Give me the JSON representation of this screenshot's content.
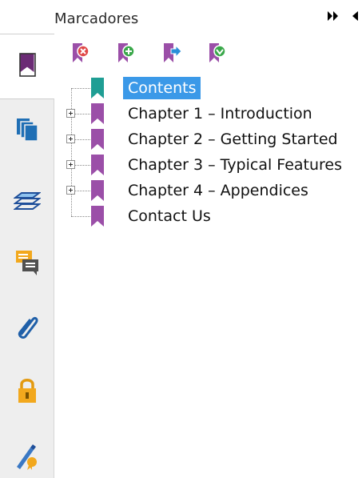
{
  "panel": {
    "title": "Marcadores",
    "controls": [
      {
        "icon": "double-arrow-right-icon",
        "glyph": "⏩"
      },
      {
        "icon": "arrow-left-icon",
        "glyph": "◀"
      }
    ]
  },
  "rail": {
    "tabs": [
      {
        "name": "bookmarks-tab",
        "icon": "bookmark-icon",
        "active": true
      },
      {
        "name": "pages-tab",
        "icon": "pages-icon",
        "active": false
      },
      {
        "name": "layers-tab",
        "icon": "layers-icon",
        "active": false
      },
      {
        "name": "comments-tab",
        "icon": "comments-icon",
        "active": false
      },
      {
        "name": "attachments-tab",
        "icon": "paperclip-icon",
        "active": false
      },
      {
        "name": "security-tab",
        "icon": "lock-icon",
        "active": false
      },
      {
        "name": "signatures-tab",
        "icon": "signature-icon",
        "active": false
      }
    ]
  },
  "toolbar": {
    "buttons": [
      {
        "name": "delete-bookmark-button",
        "icon": "delete-bookmark-icon",
        "badge_color": "#e04848"
      },
      {
        "name": "add-bookmark-button",
        "icon": "add-bookmark-icon",
        "badge_color": "#3aa84a"
      },
      {
        "name": "move-bookmark-button",
        "icon": "move-bookmark-icon",
        "badge_color": "#2a8fd8"
      },
      {
        "name": "collapse-bookmark-button",
        "icon": "collapse-bookmark-icon",
        "badge_color": "#3aa84a"
      }
    ]
  },
  "tree": {
    "items": [
      {
        "label": "Contents",
        "selected": true,
        "expandable": false,
        "bookmark_color": "#1f9e94"
      },
      {
        "label": "Chapter 1 – Introduction",
        "selected": false,
        "expandable": true,
        "bookmark_color": "#9b4fa8"
      },
      {
        "label": "Chapter 2 – Getting Started",
        "selected": false,
        "expandable": true,
        "bookmark_color": "#9b4fa8"
      },
      {
        "label": "Chapter 3 – Typical Features",
        "selected": false,
        "expandable": true,
        "bookmark_color": "#9b4fa8"
      },
      {
        "label": "Chapter 4 – Appendices",
        "selected": false,
        "expandable": true,
        "bookmark_color": "#9b4fa8"
      },
      {
        "label": "Contact Us",
        "selected": false,
        "expandable": false,
        "bookmark_color": "#9b4fa8"
      }
    ]
  },
  "colors": {
    "selection": "#3b99e8",
    "bookmark_purple": "#9b4fa8",
    "bookmark_teal": "#1f9e94"
  }
}
